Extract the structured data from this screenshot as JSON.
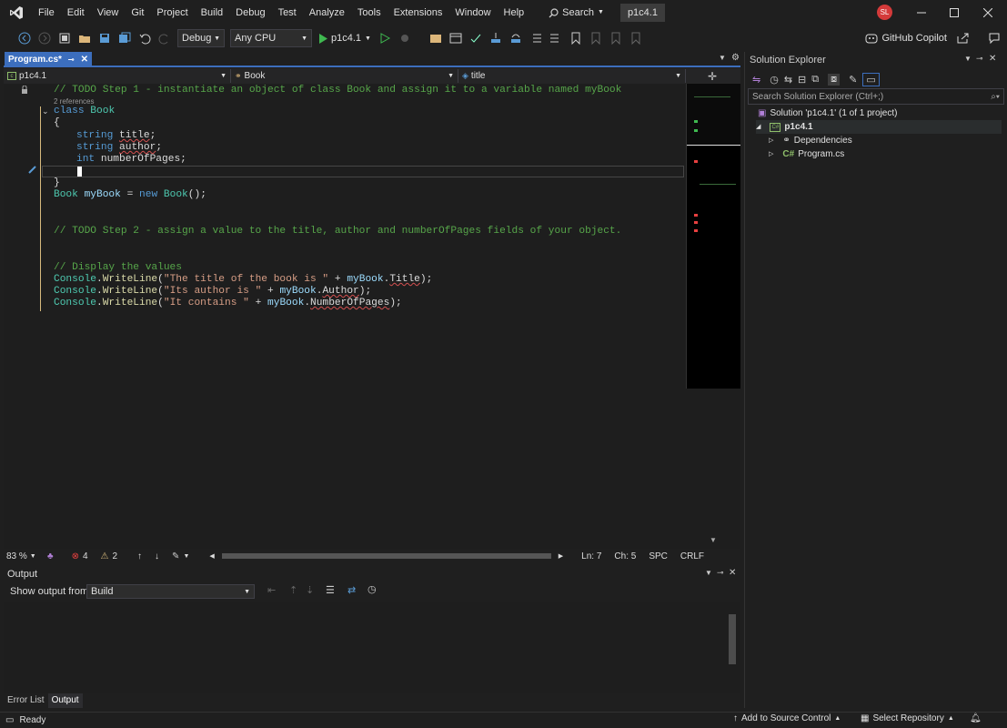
{
  "titlebar": {
    "menu": [
      "File",
      "Edit",
      "View",
      "Git",
      "Project",
      "Build",
      "Debug",
      "Test",
      "Analyze",
      "Tools",
      "Extensions",
      "Window",
      "Help"
    ],
    "search_label": "Search",
    "project_badge": "p1c4.1",
    "avatar_initials": "SL"
  },
  "toolbar": {
    "config": "Debug",
    "platform": "Any CPU",
    "run_target": "p1c4.1",
    "copilot": "GitHub Copilot"
  },
  "editor": {
    "tab_label": "Program.cs*",
    "nav_project": "p1c4.1",
    "nav_class": "Book",
    "nav_member": "title",
    "codelens": "2 references",
    "zoom": "83 %",
    "errors": "4",
    "warnings": "2",
    "ln": "Ln: 7",
    "ch": "Ch: 5",
    "spc": "SPC",
    "crlf": "CRLF"
  },
  "code": {
    "line1": "// TODO Step 1 - instantiate an object of class Book and assign it to a variable named myBook",
    "kw_class": "class",
    "ty_book": "Book",
    "brace_open": "{",
    "kw_string": "string",
    "f_title": "title",
    "f_author": "author",
    "kw_int": "int",
    "f_pages": "numberOfPages",
    "semi": ";",
    "brace_close": "}",
    "decl_type": "Book",
    "decl_var": "myBook",
    "decl_eq": " = ",
    "kw_new": "new",
    "decl_ctor": "Book",
    "decl_end": "();",
    "line_step2": "// TODO Step 2 - assign a value to the title, author and numberOfPages fields of your object.",
    "line_display": "// Display the values",
    "console": "Console",
    "dot": ".",
    "writeline": "WriteLine",
    "paren": "(",
    "str1": "\"The title of the book is \"",
    "plus": " + ",
    "obj": "myBook",
    "prop1": "Title",
    "end": ");",
    "str2": "\"Its author is \"",
    "prop2": "Author",
    "str3": "\"It contains \"",
    "prop3": "NumberOfPages"
  },
  "output": {
    "title": "Output",
    "show_from_label": "Show output from:",
    "show_from_value": "Build"
  },
  "bottom_tabs": [
    "Error List",
    "Output"
  ],
  "solution_explorer": {
    "title": "Solution Explorer",
    "search_placeholder": "Search Solution Explorer (Ctrl+;)",
    "solution": "Solution 'p1c4.1' (1 of 1 project)",
    "project": "p1c4.1",
    "dependencies": "Dependencies",
    "program": "Program.cs"
  },
  "statusbar": {
    "ready": "Ready",
    "source_control": "Add to Source Control",
    "repository": "Select Repository"
  },
  "colors": {
    "accent": "#3c6ebd",
    "comment": "#57a64a",
    "keyword": "#569cd6",
    "type": "#4ec9b0",
    "string": "#d69d85",
    "error": "#e84040"
  }
}
